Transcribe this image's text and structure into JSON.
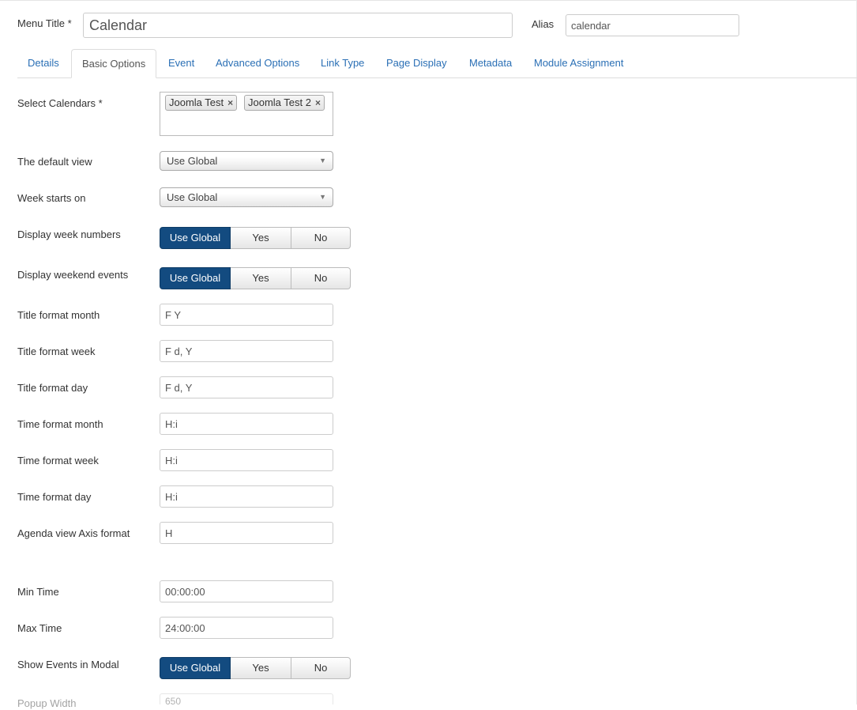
{
  "header": {
    "menu_title_label": "Menu Title *",
    "menu_title_value": "Calendar",
    "alias_label": "Alias",
    "alias_value": "calendar"
  },
  "tabs": [
    {
      "label": "Details"
    },
    {
      "label": "Basic Options",
      "active": true
    },
    {
      "label": "Event"
    },
    {
      "label": "Advanced Options"
    },
    {
      "label": "Link Type"
    },
    {
      "label": "Page Display"
    },
    {
      "label": "Metadata"
    },
    {
      "label": "Module Assignment"
    }
  ],
  "fields": {
    "select_calendars": {
      "label": "Select Calendars *",
      "chips": [
        "Joomla Test",
        "Joomla Test 2"
      ],
      "remove_glyph": "×"
    },
    "default_view": {
      "label": "The default view",
      "value": "Use Global"
    },
    "week_starts_on": {
      "label": "Week starts on",
      "value": "Use Global"
    },
    "display_week_numbers": {
      "label": "Display week numbers",
      "options": [
        "Use Global",
        "Yes",
        "No"
      ],
      "selected": "Use Global"
    },
    "display_weekend_events": {
      "label": "Display weekend events",
      "options": [
        "Use Global",
        "Yes",
        "No"
      ],
      "selected": "Use Global"
    },
    "title_format_month": {
      "label": "Title format month",
      "value": "F Y"
    },
    "title_format_week": {
      "label": "Title format week",
      "value": "F d, Y"
    },
    "title_format_day": {
      "label": "Title format day",
      "value": "F d, Y"
    },
    "time_format_month": {
      "label": "Time format month",
      "value": "H:i"
    },
    "time_format_week": {
      "label": "Time format week",
      "value": "H:i"
    },
    "time_format_day": {
      "label": "Time format day",
      "value": "H:i"
    },
    "agenda_axis_format": {
      "label": "Agenda view Axis format",
      "value": "H"
    },
    "min_time": {
      "label": "Min Time",
      "value": "00:00:00"
    },
    "max_time": {
      "label": "Max Time",
      "value": "24:00:00"
    },
    "show_events_in_modal": {
      "label": "Show Events in Modal",
      "options": [
        "Use Global",
        "Yes",
        "No"
      ],
      "selected": "Use Global"
    },
    "popup_width": {
      "label": "Popup Width",
      "value": "650"
    }
  },
  "colors": {
    "active_toggle": "#134b80",
    "tab_link": "#2a6fb5"
  },
  "icons": {
    "dropdown": "triangle-down",
    "remove": "x-mark"
  }
}
